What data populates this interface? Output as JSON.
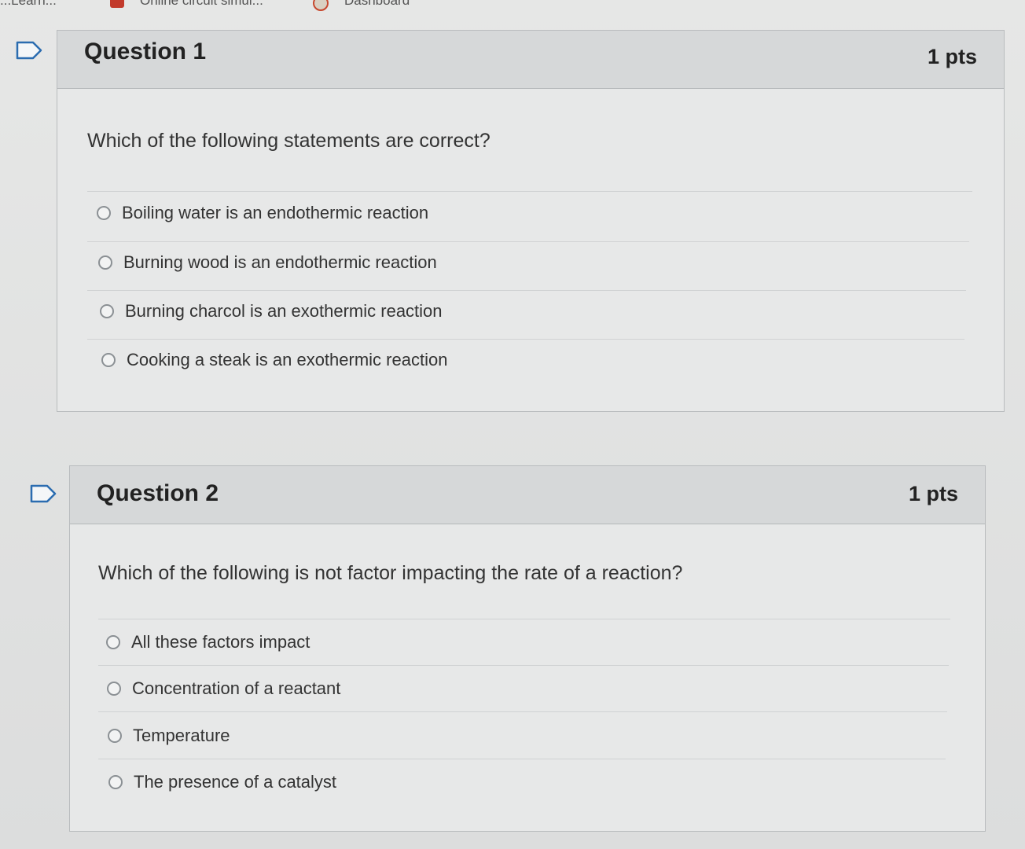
{
  "bookmarks": [
    {
      "label": "...Learn...",
      "icon": "bookmark-icon"
    },
    {
      "label": "Online circuit simul...",
      "icon": "circuit-icon",
      "color": "#c23a2b"
    },
    {
      "label": "Dashboard",
      "icon": "dashboard-icon",
      "color": "#c7482e"
    }
  ],
  "questions": [
    {
      "title": "Question 1",
      "points": "1 pts",
      "text": "Which of the following statements are correct?",
      "answers": [
        "Boiling water is an endothermic reaction",
        "Burning wood is an endothermic reaction",
        "Burning charcol is an exothermic reaction",
        "Cooking a steak is an exothermic reaction"
      ]
    },
    {
      "title": "Question 2",
      "points": "1 pts",
      "text": "Which of the following is not factor impacting the rate of a reaction?",
      "answers": [
        "All these factors impact",
        "Concentration of a reactant",
        "Temperature",
        "The presence of a catalyst"
      ]
    }
  ],
  "colors": {
    "flag_outline": "#2b6cb0",
    "header_bg": "#d6d8d9",
    "card_bg": "#e7e8e8"
  }
}
